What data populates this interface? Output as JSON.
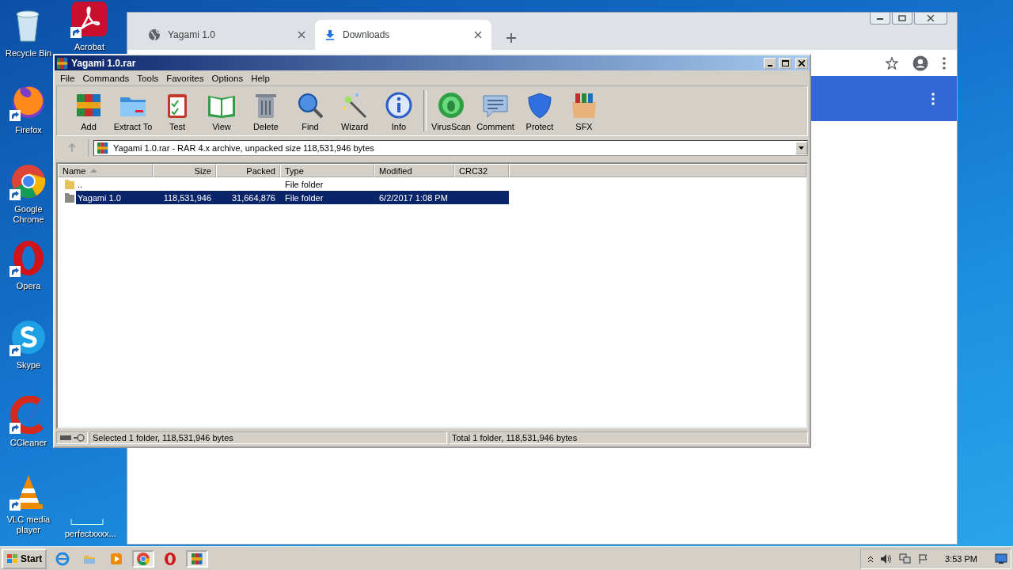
{
  "desktop_icons": [
    {
      "kind": "recycle",
      "label": "Recycle Bin",
      "shortcut": false
    },
    {
      "kind": "firefox",
      "label": "Firefox",
      "shortcut": true
    },
    {
      "kind": "chrome",
      "label": "Google Chrome",
      "shortcut": true
    },
    {
      "kind": "opera",
      "label": "Opera",
      "shortcut": true
    },
    {
      "kind": "skype",
      "label": "Skype",
      "shortcut": true
    },
    {
      "kind": "ccleaner",
      "label": "CCleaner",
      "shortcut": true
    },
    {
      "kind": "vlc",
      "label": "VLC media player",
      "shortcut": true
    },
    {
      "kind": "acrobat",
      "label": "Acrobat",
      "shortcut": true
    },
    {
      "kind": "blank",
      "label": "perfectxxxx...",
      "shortcut": false
    }
  ],
  "browser": {
    "tabs": [
      {
        "title": "Yagami 1.0",
        "kind": "globe",
        "selected": false
      },
      {
        "title": "Downloads",
        "kind": "download",
        "selected": true
      }
    ]
  },
  "winrar": {
    "title": "Yagami 1.0.rar",
    "menu": [
      "File",
      "Commands",
      "Tools",
      "Favorites",
      "Options",
      "Help"
    ],
    "toolbar": [
      {
        "kind": "add",
        "label": "Add"
      },
      {
        "kind": "extract",
        "label": "Extract To"
      },
      {
        "kind": "test",
        "label": "Test"
      },
      {
        "kind": "view",
        "label": "View"
      },
      {
        "kind": "delete",
        "label": "Delete"
      },
      {
        "kind": "find",
        "label": "Find"
      },
      {
        "kind": "wizard",
        "label": "Wizard"
      },
      {
        "kind": "info",
        "label": "Info"
      },
      {
        "kind": "separator"
      },
      {
        "kind": "virusscan",
        "label": "VirusScan"
      },
      {
        "kind": "comment",
        "label": "Comment"
      },
      {
        "kind": "protect",
        "label": "Protect"
      },
      {
        "kind": "sfx",
        "label": "SFX"
      }
    ],
    "path": "Yagami 1.0.rar - RAR 4.x archive, unpacked size 118,531,946 bytes",
    "columns": [
      {
        "label": "Name",
        "sorted": true
      },
      {
        "label": "Size",
        "sorted": false
      },
      {
        "label": "Packed",
        "sorted": false
      },
      {
        "label": "Type",
        "sorted": false
      },
      {
        "label": "Modified",
        "sorted": false
      },
      {
        "label": "CRC32",
        "sorted": false
      }
    ],
    "rows": [
      {
        "name": "..",
        "type": "File folder",
        "kind": "up",
        "selected": false
      },
      {
        "name": "Yagami 1.0",
        "size": "118,531,946",
        "packed": "31,664,876",
        "type": "File folder",
        "modified": "6/2/2017 1:08 PM",
        "kind": "folder",
        "selected": true
      }
    ],
    "status_left": "Selected 1 folder, 118,531,946 bytes",
    "status_right": "Total 1 folder, 118,531,946 bytes"
  },
  "taskbar": {
    "start": "Start",
    "apps": [
      {
        "kind": "ie",
        "active": false
      },
      {
        "kind": "explorer",
        "active": false
      },
      {
        "kind": "media",
        "active": false
      },
      {
        "kind": "chrome",
        "active": true
      },
      {
        "kind": "opera",
        "active": false
      },
      {
        "kind": "winrar",
        "active": true
      }
    ],
    "clock": "3:53 PM"
  }
}
